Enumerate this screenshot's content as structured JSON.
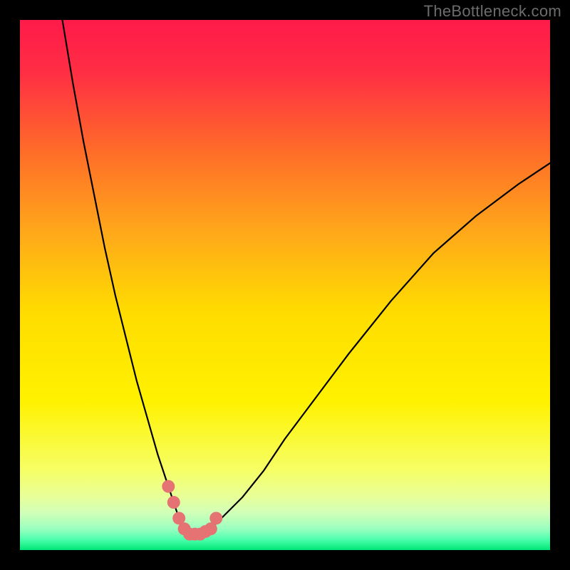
{
  "watermark": "TheBottleneck.com",
  "chart_data": {
    "type": "line",
    "title": "",
    "xlabel": "",
    "ylabel": "",
    "xlim": [
      0,
      100
    ],
    "ylim": [
      0,
      100
    ],
    "gradient_colors": {
      "top": "#ff1a4a",
      "upper_mid": "#ff7a1f",
      "mid": "#ffde00",
      "lower_mid": "#f8ff7a",
      "lower1": "#d8ffb4",
      "bottom": "#00e676"
    },
    "series": [
      {
        "name": "bottleneck-curve",
        "type": "line",
        "color": "#000000",
        "x": [
          8,
          10,
          12,
          14,
          16,
          18,
          20,
          22,
          24,
          26,
          28,
          29,
          30,
          31,
          32,
          33,
          34,
          36,
          38,
          42,
          46,
          50,
          56,
          62,
          70,
          78,
          86,
          94,
          100
        ],
        "y": [
          100,
          88,
          77,
          67,
          57,
          48,
          40,
          32,
          25,
          18,
          12,
          9,
          6,
          4,
          3,
          3,
          3,
          4,
          6,
          10,
          15,
          21,
          29,
          37,
          47,
          56,
          63,
          69,
          73
        ]
      },
      {
        "name": "highlight-points",
        "type": "scatter",
        "color": "#e57373",
        "x": [
          28,
          29,
          30,
          31,
          32,
          33,
          34,
          35,
          36,
          37
        ],
        "y": [
          12,
          9,
          6,
          4,
          3,
          3,
          3,
          3.5,
          4,
          6
        ]
      }
    ]
  }
}
